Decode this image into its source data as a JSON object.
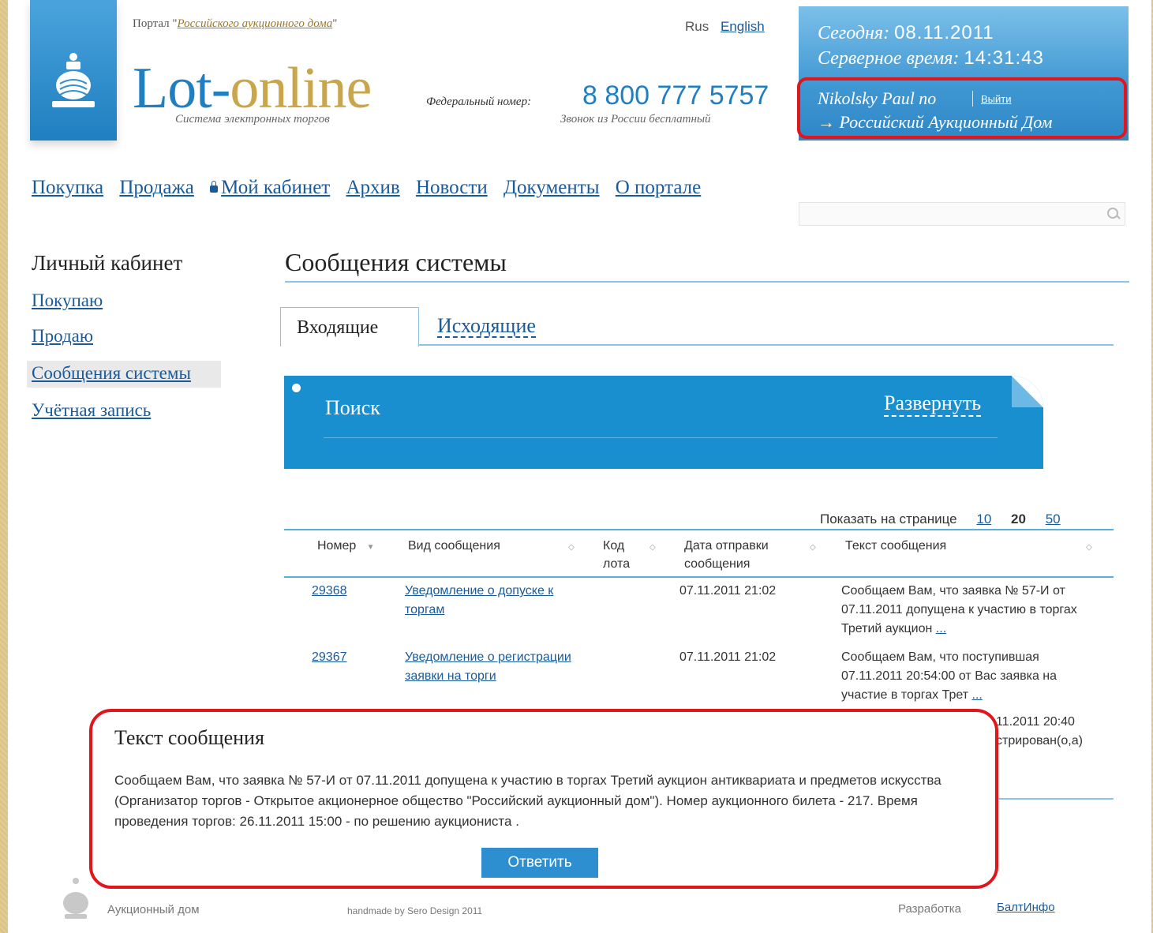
{
  "header": {
    "portal_prefix": "Портал \"",
    "portal_link": "Российского аукционного дома",
    "portal_suffix": "\"",
    "brand_part1": "Lot-",
    "brand_part2": "online",
    "tagline": "Система электронных торгов",
    "lang_current": "Rus",
    "lang_other": "English",
    "fed_label": "Федеральный номер:",
    "fed_number": "8 800 777 5757",
    "fed_note": "Звонок из России бесплатный",
    "date_label": "Сегодня:",
    "date_value": "08.11.2011",
    "time_label": "Серверное время:",
    "time_value": "14:31:43",
    "user_name": "Nikolsky Paul no",
    "logout": "Выйти",
    "org": "→ Российский Аукционный Дом"
  },
  "nav": [
    "Покупка",
    "Продажа",
    "Мой кабинет",
    "Архив",
    "Новости",
    "Документы",
    "О портале"
  ],
  "sidebar": {
    "title": "Личный кабинет",
    "items": [
      "Покупаю",
      "Продаю",
      "Сообщения системы",
      "Учётная запись"
    ]
  },
  "main": {
    "title": "Сообщения системы",
    "tab_active": "Входящие",
    "tab_other": "Исходящие",
    "search_title": "Поиск",
    "search_expand": "Развернуть",
    "pager_label": "Показать на странице",
    "pager_options": [
      "10",
      "20",
      "50"
    ],
    "columns": [
      "Номер",
      "Вид сообщения",
      "Код лота",
      "Дата отправки сообщения",
      "Текст сообщения"
    ],
    "rows": [
      {
        "number": "29368",
        "type": "Уведомление о допуске к торгам",
        "lot": "",
        "date": "07.11.2011 21:02",
        "text": "Сообщаем Вам, что заявка № 57-И от 07.11.2011 допущена к участию в торгах Третий аукцион",
        "more": "..."
      },
      {
        "number": "29367",
        "type": "Уведомление о регистрации заявки на торги",
        "lot": "",
        "date": "07.11.2011 21:02",
        "text": "Сообщаем Вам, что поступившая 07.11.2011 20:54:00 от Вас заявка на участие в торгах Трет",
        "more": "..."
      }
    ],
    "row3_fragment1": "11.2011 20:40",
    "row3_fragment2": "стрирован(о,а)"
  },
  "popup": {
    "title": "Текст сообщения",
    "body": "Сообщаем Вам, что заявка № 57-И от 07.11.2011 допущена к участию в торгах Третий аукцион антиквариата и предметов искусства (Организатор торгов - Открытое акционерное общество \"Российский аукционный дом\"). Номер аукционного билета - 217. Время проведения торгов: 26.11.2011 15:00 - по решению аукциониста .",
    "reply": "Ответить"
  },
  "footer": {
    "company": "Аукционный дом",
    "credit": "handmade by Sero Design 2011",
    "dev_label": "Разработка",
    "dev_link": "БалтИнфо"
  }
}
